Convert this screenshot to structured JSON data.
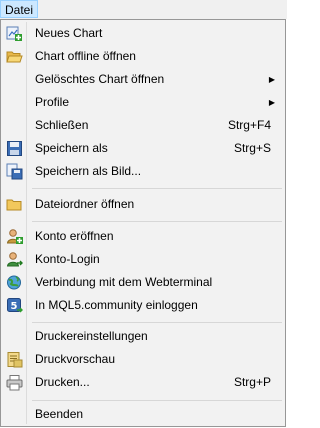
{
  "menubar": {
    "label": "Datei"
  },
  "menu": {
    "items": [
      {
        "label": "Neues Chart",
        "icon": "new-chart-icon"
      },
      {
        "label": "Chart offline öffnen",
        "icon": "folder-open-icon"
      },
      {
        "label": "Gelöschtes Chart öffnen",
        "submenu": true
      },
      {
        "label": "Profile",
        "submenu": true
      },
      {
        "label": "Schließen",
        "shortcut": "Strg+F4"
      },
      {
        "label": "Speichern als",
        "icon": "save-icon",
        "shortcut": "Strg+S"
      },
      {
        "label": "Speichern als Bild...",
        "icon": "save-image-icon"
      },
      {
        "label": "Dateiordner öffnen",
        "icon": "folder-icon"
      },
      {
        "label": "Konto eröffnen",
        "icon": "user-add-icon"
      },
      {
        "label": "Konto-Login",
        "icon": "user-login-icon"
      },
      {
        "label": "Verbindung mit dem Webterminal",
        "icon": "web-terminal-icon"
      },
      {
        "label": "In MQL5.community einloggen",
        "icon": "mql5-icon"
      },
      {
        "label": "Druckereinstellungen"
      },
      {
        "label": "Druckvorschau",
        "icon": "print-preview-icon"
      },
      {
        "label": "Drucken...",
        "icon": "printer-icon",
        "shortcut": "Strg+P"
      },
      {
        "label": "Beenden"
      }
    ]
  }
}
